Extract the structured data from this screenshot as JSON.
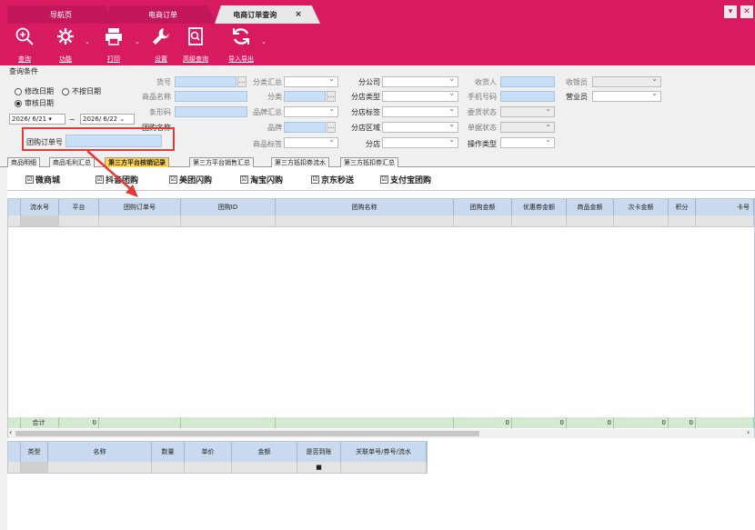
{
  "tabs": [
    "导航页",
    "电商订单",
    "电商订单查询"
  ],
  "tab_close": "×",
  "window_buttons": [
    "▾",
    "✕"
  ],
  "toolbar": {
    "buttons": [
      {
        "label": "查询",
        "icon": "search-icon"
      },
      {
        "label": "功能",
        "icon": "gear-icon"
      },
      {
        "label": "打印",
        "icon": "printer-icon"
      },
      {
        "label": "设置",
        "icon": "wrench-icon"
      },
      {
        "label": "高级查询",
        "icon": "advanced-search-icon"
      },
      {
        "label": "导入导出",
        "icon": "refresh-icon"
      }
    ]
  },
  "query": {
    "title": "查询条件",
    "radio_modify_date": "修改日期",
    "radio_no_date": "不按日期",
    "radio_audit_date": "审核日期",
    "date_from": "2026/ 6/21",
    "date_sep": "~",
    "date_to": "2026/ 6/22",
    "labels": {
      "huohao": "货号",
      "goods_name": "商品名称",
      "barcode": "条形码",
      "group_name": "团购名称",
      "category_summary": "分类汇总",
      "category": "分类",
      "brand_summary": "品牌汇总",
      "brand": "品牌",
      "goods_tag": "商品标签",
      "branch_company": "分公司",
      "store_type": "分店类型",
      "store_tag": "分店标签",
      "store_area": "分店区域",
      "store": "分店",
      "op_type": "操作类型",
      "receiver": "收货人",
      "phone": "手机号码",
      "ship_status": "委货状态",
      "doc_status": "单据状态",
      "cashier": "收银员",
      "salesman": "营业员",
      "group_order_no": "团购订单号"
    },
    "ellipsis": "..."
  },
  "subtabs": [
    "商品明细",
    "商品毛利汇总",
    "第三方平台核销记录",
    "第三方平台销售汇总",
    "第三方抵扣券流水",
    "第三方抵扣券汇总"
  ],
  "platforms": [
    "微商城",
    "抖音团购",
    "美团闪购",
    "淘宝闪购",
    "京东秒送",
    "支付宝团购"
  ],
  "check_mark": "☑",
  "grid": {
    "columns": [
      "流水号",
      "平台",
      "团购订单号",
      "团购ID",
      "团购名称",
      "团购金额",
      "优惠券金额",
      "商品金额",
      "次卡金额",
      "积分",
      "卡号"
    ],
    "total_label": "合计",
    "totals": [
      "0",
      "0",
      "0",
      "0",
      "0",
      "0"
    ]
  },
  "scroll_left": "‹",
  "scroll_right": "›",
  "grid2": {
    "columns": [
      "类型",
      "名称",
      "数量",
      "单价",
      "金额",
      "是否到账",
      "关联单号/券号/流水"
    ],
    "filter_mark": "■"
  }
}
